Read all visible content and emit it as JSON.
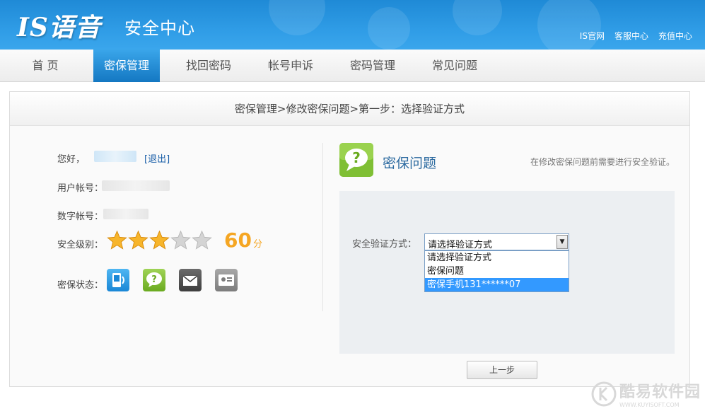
{
  "header": {
    "logo": "IS语音",
    "subtitle": "安全中心",
    "links": [
      "IS官网",
      "客服中心",
      "充值中心"
    ]
  },
  "nav": {
    "items": [
      "首 页",
      "密保管理",
      "找回密码",
      "帐号申诉",
      "密码管理",
      "常见问题"
    ],
    "active_index": 1
  },
  "breadcrumb": "密保管理>修改密保问题>第一步：选择验证方式",
  "account": {
    "greeting": "您好，",
    "logout": "[退出]",
    "user_account_label": "用户帐号：",
    "digital_account_label": "数字帐号：",
    "security_level_label": "安全级别：",
    "stars_filled": 3,
    "stars_total": 5,
    "score": "60",
    "score_unit": "分",
    "protection_status_label": "密保状态："
  },
  "security_question": {
    "title": "密保问题",
    "note": "在修改密保问题前需要进行安全验证。",
    "verify_label": "安全验证方式：",
    "select_value": "请选择验证方式",
    "options": [
      "请选择验证方式",
      "密保问题",
      "密保手机131******07"
    ],
    "highlighted_option": 2
  },
  "buttons": {
    "prev": "上一步"
  },
  "watermark": {
    "brand": "酷易软件园",
    "url": "WWW.KUYISOFT.COM"
  },
  "colors": {
    "header_blue": "#2f9ce6",
    "nav_active": "#1478c2",
    "score_orange": "#f5a623",
    "title_blue": "#2c6aa0",
    "option_highlight": "#3399ff"
  }
}
